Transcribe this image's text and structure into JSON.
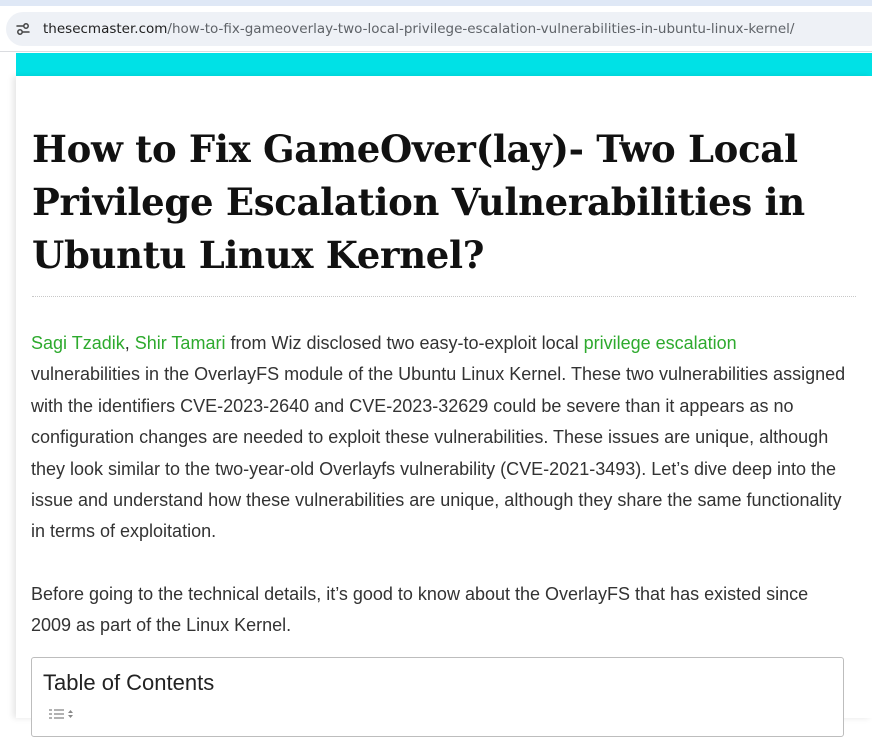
{
  "browser": {
    "url_host": "thesecmaster.com",
    "url_path": "/how-to-fix-gameoverlay-two-local-privilege-escalation-vulnerabilities-in-ubuntu-linux-kernel/"
  },
  "colors": {
    "accent_bar": "#00e1e6",
    "link": "#2eaa2e"
  },
  "article": {
    "title": "How to Fix GameOver(lay)- Two Local Privilege Escalation Vulnerabilities in Ubuntu Linux Kernel?",
    "intro": {
      "author_link_1": "Sagi Tzadik",
      "separator": ",",
      "author_link_2": "Shir Tamari",
      "text_1": "from Wiz disclosed two easy-to-exploit local",
      "topic_link": "privilege escalation",
      "text_2": "vulnerabilities in the OverlayFS module of the Ubuntu Linux Kernel. These two vulnerabilities assigned with the identifiers CVE-2023-2640 and CVE-2023-32629 could be severe than it appears as no configuration changes are needed to exploit these vulnerabilities. These issues are unique, although they look similar to the two-year-old Overlayfs vulnerability (CVE-2021-3493). Let’s dive deep into the issue and understand how these vulnerabilities are unique, although they share the same functionality in terms of exploitation."
    },
    "paragraph_2": "Before going to the technical details, it’s good to know about the OverlayFS that has existed since 2009 as part of the Linux Kernel."
  },
  "toc": {
    "title": "Table of Contents",
    "toggle_icon": "list-toggle-icon"
  }
}
